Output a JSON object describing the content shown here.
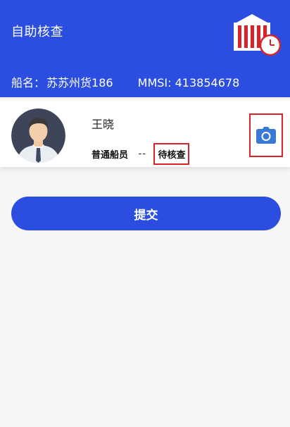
{
  "header": {
    "title": "自助核查",
    "illustration": "building-clock-icon"
  },
  "ship": {
    "name_label": "船名：",
    "name_value": "苏苏州货186",
    "mmsi_label": "MMSI:",
    "mmsi_value": "413854678"
  },
  "crew": {
    "name": "王晓",
    "role": "普通船员",
    "separator": "--",
    "status": "待核查",
    "avatar_icon": "person-avatar-icon",
    "camera_icon": "camera-icon"
  },
  "actions": {
    "submit_label": "提交"
  },
  "colors": {
    "primary": "#2b4ee0",
    "highlight_border": "#d8232a",
    "camera": "#3a78d6",
    "background": "#f6f6f7"
  }
}
